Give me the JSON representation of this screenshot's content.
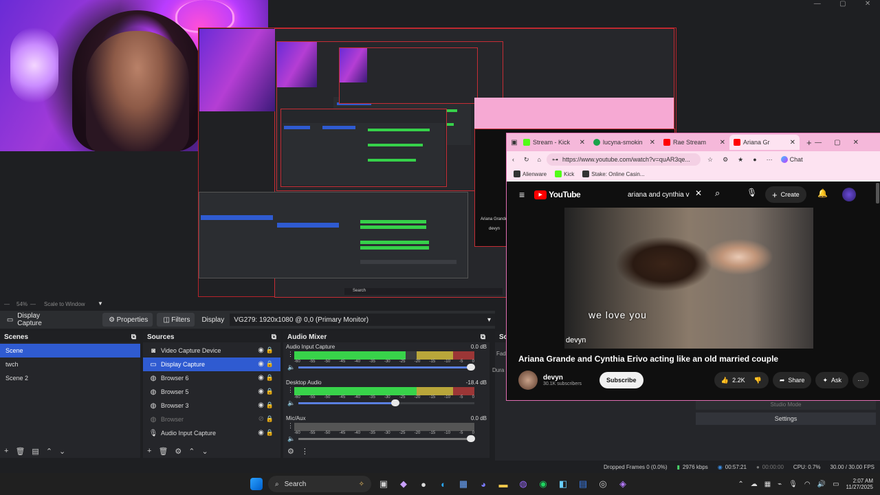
{
  "window_controls": [
    "—",
    "▢",
    "✕"
  ],
  "preview": {
    "zoom_label": "54%",
    "scale_label": "Scale to Window",
    "mini_youtube_channel": "Ariana Grande",
    "mini_channel": "devyn",
    "mini_search": "Search"
  },
  "source_toolbar": {
    "source_name": "Display Capture",
    "properties_label": "Properties",
    "filters_label": "Filters",
    "display_label": "Display",
    "display_value": "VG279: 1920x1080 @ 0,0 (Primary Monitor)"
  },
  "scenes": {
    "title": "Scenes",
    "items": [
      {
        "label": "Scene",
        "selected": true
      },
      {
        "label": "twch",
        "selected": false
      },
      {
        "label": "Scene 2",
        "selected": false
      }
    ]
  },
  "sources": {
    "title": "Sources",
    "items": [
      {
        "label": "Video Capture Device",
        "icon": "camera-icon",
        "visible": true,
        "selected": false
      },
      {
        "label": "Display Capture",
        "icon": "monitor-icon",
        "visible": true,
        "selected": true
      },
      {
        "label": "Browser 6",
        "icon": "globe-icon",
        "visible": true,
        "selected": false
      },
      {
        "label": "Browser 5",
        "icon": "globe-icon",
        "visible": true,
        "selected": false
      },
      {
        "label": "Browser 3",
        "icon": "globe-icon",
        "visible": true,
        "selected": false
      },
      {
        "label": "Browser",
        "icon": "globe-icon",
        "visible": false,
        "selected": false
      },
      {
        "label": "Audio Input Capture",
        "icon": "microphone-icon",
        "visible": true,
        "selected": false
      }
    ]
  },
  "audio_mixer": {
    "title": "Audio Mixer",
    "ticks": [
      "-60",
      "-55",
      "-50",
      "-45",
      "-40",
      "-35",
      "-30",
      "-25",
      "-20",
      "-15",
      "-10",
      "-5",
      "0"
    ],
    "channels": [
      {
        "name": "Audio Input Capture",
        "db": "0.0 dB",
        "level": 0.62,
        "volume": 0.98
      },
      {
        "name": "Desktop Audio",
        "db": "-18.4 dB",
        "level": 0.68,
        "volume": 0.55
      },
      {
        "name": "Mic/Aux",
        "db": "0.0 dB",
        "level": 0.0,
        "volume": 0.98
      }
    ]
  },
  "right_dock": {
    "title": "Sce",
    "fade_label": "Fad",
    "duration_label": "Dura",
    "studio_mode": "Studio Mode",
    "settings": "Settings"
  },
  "status": {
    "dropped_frames": "Dropped Frames 0 (0.0%)",
    "bitrate": "2976 kbps",
    "live_time": "00:57:21",
    "rec_time": "00:00:00",
    "cpu": "CPU: 0.7%",
    "fps": "30.00 / 30.00 FPS"
  },
  "browser": {
    "tabs": [
      {
        "label": "Stream - Kick",
        "color": "#53fc18",
        "active": false
      },
      {
        "label": "lucyna-smokin",
        "color": "#1aa34a",
        "active": false
      },
      {
        "label": "Rae Stream",
        "color": "#ff0000",
        "active": false
      },
      {
        "label": "Ariana Gr",
        "color": "#ff0000",
        "active": true
      }
    ],
    "new_tab": "+",
    "url": "https://www.youtube.com/watch?v=quAR3qe...",
    "chat_label": "Chat",
    "bookmarks": [
      {
        "label": "Alienware",
        "color": "#333333"
      },
      {
        "label": "Kick",
        "color": "#53fc18"
      },
      {
        "label": "Stake: Online Casin...",
        "color": "#333333"
      }
    ],
    "youtube": {
      "logo_text": "YouTube",
      "search_value": "ariana and cynthia v",
      "create_label": "Create",
      "caption": "we love you",
      "watermark": "devyn",
      "video_title": "Ariana Grande and Cynthia Erivo acting like an old married couple",
      "channel_name": "devyn",
      "subscribers": "30.1K subscribers",
      "subscribe_label": "Subscribe",
      "likes": "2.2K",
      "share_label": "Share",
      "ask_label": "Ask"
    }
  },
  "taskbar": {
    "search_label": "Search",
    "time": "2:07 AM",
    "date": "11/27/2025"
  }
}
